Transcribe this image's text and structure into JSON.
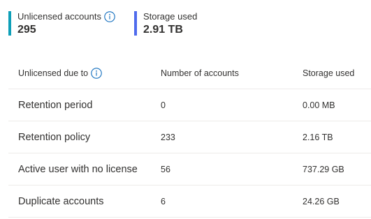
{
  "kpis": [
    {
      "label": "Unlicensed accounts",
      "value": "295",
      "bar_color": "#0e9fb8",
      "has_info": true
    },
    {
      "label": "Storage used",
      "value": "2.91 TB",
      "bar_color": "#4f6bed",
      "has_info": false
    }
  ],
  "table": {
    "headers": [
      "Unlicensed due to",
      "Number of accounts",
      "Storage used"
    ],
    "rows": [
      {
        "reason": "Retention period",
        "accounts": "0",
        "storage": "0.00 MB"
      },
      {
        "reason": "Retention policy",
        "accounts": "233",
        "storage": "2.16 TB"
      },
      {
        "reason": "Active user with no license",
        "accounts": "56",
        "storage": "737.29 GB"
      },
      {
        "reason": "Duplicate accounts",
        "accounts": "6",
        "storage": "24.26 GB"
      }
    ]
  },
  "colors": {
    "info_icon": "#0f6cbd",
    "divider": "#edebe9",
    "text": "#323130"
  },
  "icons": {
    "info": "info-icon"
  }
}
